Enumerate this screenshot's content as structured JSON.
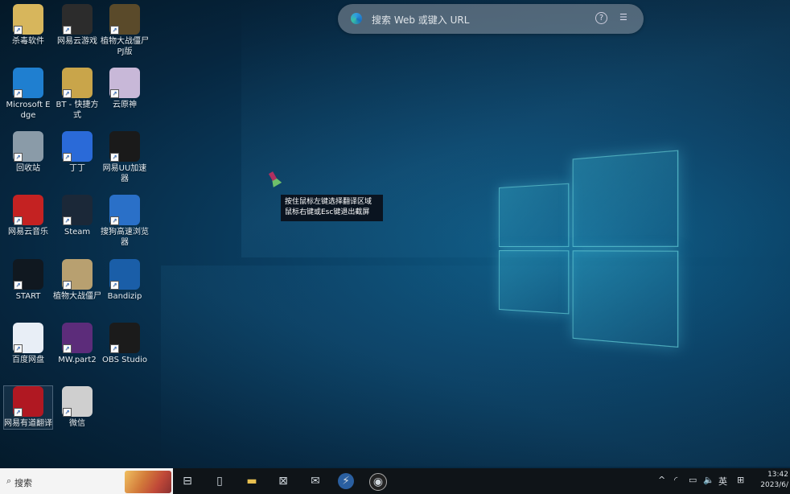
{
  "browser_bar": {
    "placeholder": "搜索 Web 或键入 URL",
    "help_label": "?"
  },
  "tooltip": {
    "line1": "按住鼠标左键选择翻译区域",
    "line2": "鼠标右键或Esc键退出截屏"
  },
  "desktop_icons": [
    {
      "label": "杀毒软件",
      "icon": "folder-icon",
      "color": "#d7b65c"
    },
    {
      "label": "网易云游戏",
      "icon": "netease-cloud-game-icon",
      "color": "#2c2c2c"
    },
    {
      "label": "植物大战僵尸PJ版",
      "icon": "plants-vs-zombies-icon",
      "color": "#5a4a2a"
    },
    {
      "label": "Microsoft Edge",
      "icon": "edge-icon",
      "color": "#1f7fd0"
    },
    {
      "label": "BT - 快捷方式",
      "icon": "bt-folder-icon",
      "color": "#c9a54a"
    },
    {
      "label": "云原神",
      "icon": "genshin-cloud-icon",
      "color": "#c8b8d8"
    },
    {
      "label": "回收站",
      "icon": "recycle-bin-icon",
      "color": "#8a9ba8"
    },
    {
      "label": "丁丁",
      "icon": "dingding-icon",
      "color": "#2a6ad8"
    },
    {
      "label": "网易UU加速器",
      "icon": "uu-accelerator-icon",
      "color": "#1a1a1a"
    },
    {
      "label": "网易云音乐",
      "icon": "netease-music-icon",
      "color": "#c42222"
    },
    {
      "label": "Steam",
      "icon": "steam-icon",
      "color": "#1b2838"
    },
    {
      "label": "搜狗高速浏览器",
      "icon": "sogou-browser-icon",
      "color": "#2a70c8"
    },
    {
      "label": "START",
      "icon": "start-icon",
      "color": "#101820"
    },
    {
      "label": "植物大战僵尸",
      "icon": "pvz-icon",
      "color": "#b8a070"
    },
    {
      "label": "Bandizip",
      "icon": "bandizip-icon",
      "color": "#1a5ea8"
    },
    {
      "label": "百度网盘",
      "icon": "baidu-netdisk-icon",
      "color": "#e8eef6"
    },
    {
      "label": "MW.part2",
      "icon": "rar-icon",
      "color": "#5c2c7a"
    },
    {
      "label": "OBS Studio",
      "icon": "obs-icon",
      "color": "#1b1b1b"
    },
    {
      "label": "网易有道翻译",
      "icon": "youdao-icon",
      "color": "#b01822"
    },
    {
      "label": "微信",
      "icon": "file-icon",
      "color": "#cfcfcf"
    }
  ],
  "taskbar": {
    "search_text": "搜索",
    "apps": [
      "task-view-icon",
      "file-icon",
      "file-explorer-icon",
      "store-icon",
      "mail-icon",
      "bandizip-icon",
      "obs-icon"
    ],
    "tray": {
      "chevron": "^",
      "ime": "英",
      "grid": "⊞"
    },
    "time": "13:42",
    "date": "2023/6/"
  }
}
